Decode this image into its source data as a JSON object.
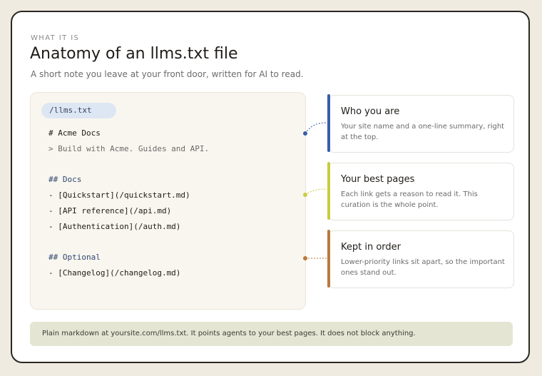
{
  "header": {
    "eyebrow": "WHAT IT IS",
    "title": "Anatomy of an llms.txt file",
    "subtitle": "A short note you leave at your front door, written for AI to read."
  },
  "file": {
    "name": "/llms.txt",
    "lines": {
      "h1": "# Acme Docs",
      "quote": "> Build with Acme. Guides and API.",
      "docs_heading": "## Docs",
      "item1": "- [Quickstart](/quickstart.md)",
      "item2": "- [API reference](/api.md)",
      "item3": "- [Authentication](/auth.md)",
      "optional_heading": "## Optional",
      "item4": "- [Changelog](/changelog.md)"
    }
  },
  "annotations": [
    {
      "title": "Who you are",
      "body": "Your site name and a one-line summary, right at the top.",
      "color": "#3a5da8"
    },
    {
      "title": "Your best pages",
      "body": "Each link gets a reason to read it. This curation is the whole point.",
      "color": "#c9cc3f"
    },
    {
      "title": "Kept in order",
      "body": "Lower-priority links sit apart, so the important ones stand out.",
      "color": "#b87a3e"
    }
  ],
  "footer": {
    "note": "Plain markdown at yoursite.com/llms.txt. It points agents to your best pages. It does not block anything."
  }
}
